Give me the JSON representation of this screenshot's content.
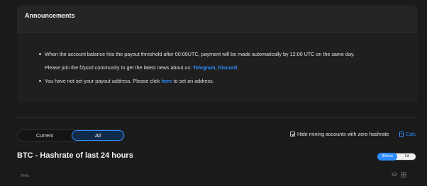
{
  "announcements": {
    "title": "Announcements",
    "line1": "When the account balance hits the payout threshold after 00:00UTC, payment will be made automatically by 12:00 UTC on the same day.",
    "line2_prefix": "Please join the f2pool community to get the latest news about us: ",
    "line2_link1": "Telegram",
    "line2_sep": ", ",
    "line2_link2": "Discord",
    "line2_suffix": ".",
    "line3_prefix": "You have not set your payout address. Please click ",
    "line3_link": "here",
    "line3_suffix": " to set an address."
  },
  "tabs": {
    "current": "Current",
    "all": "All",
    "selected": "All"
  },
  "filters": {
    "hide_zero_label": "Hide mining accounts with zero hashrate",
    "hide_zero_checked": true,
    "calc_label": "Calc"
  },
  "chart": {
    "title": "BTC - Hashrate of last 24 hours",
    "range_30min": "30min",
    "range_1d": "1d",
    "selected_range": "30min",
    "unit": "TH/s"
  },
  "icons": {
    "layers": "layers-icon",
    "grid": "grid-icon",
    "calc": "calculator-icon",
    "checkbox": "checkbox-icon"
  },
  "colors": {
    "background": "#1a1a1a",
    "panel": "#1f1f1f",
    "accent": "#2d8cff"
  }
}
